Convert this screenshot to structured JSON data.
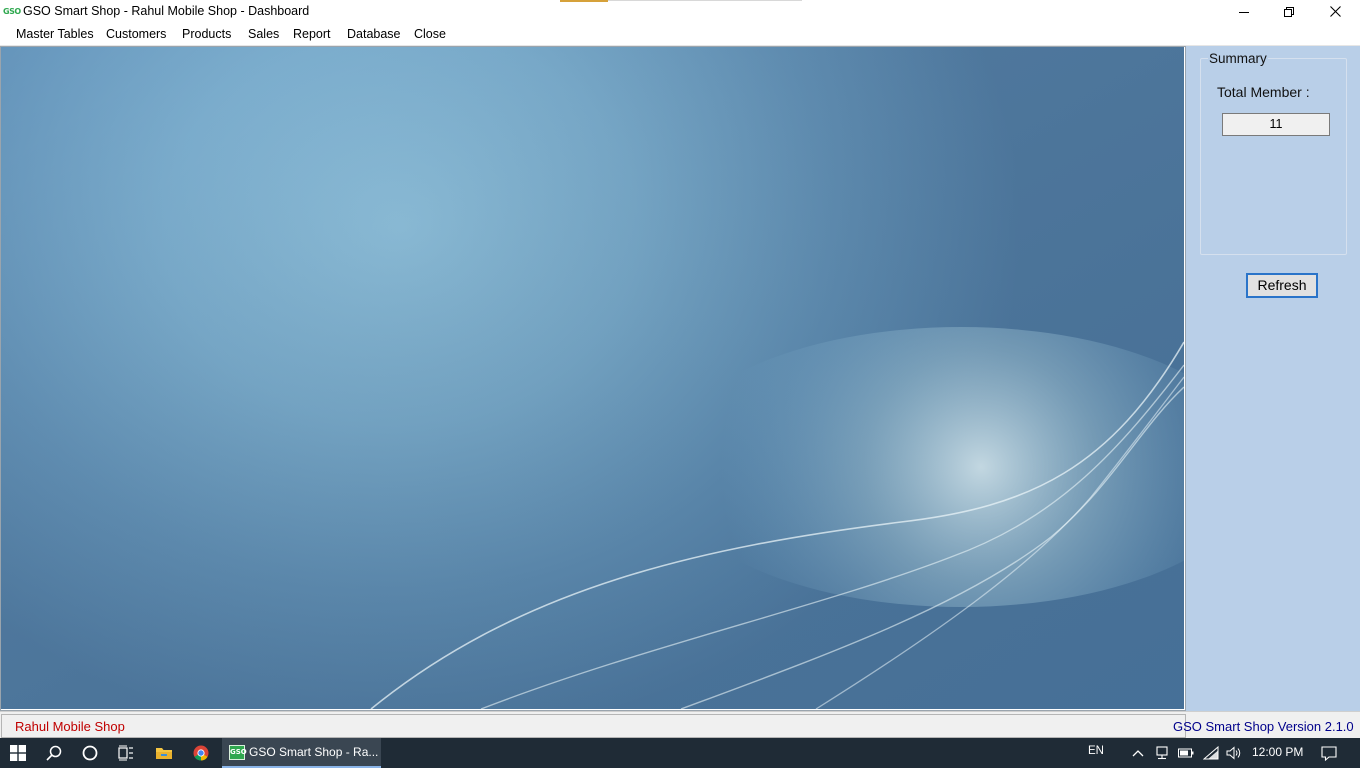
{
  "window": {
    "logo_text": "GSO",
    "title": "GSO Smart Shop - Rahul Mobile Shop - Dashboard",
    "controls": [
      "minimize",
      "restore",
      "close"
    ]
  },
  "menu": {
    "items": [
      "Master Tables",
      "Customers",
      "Products",
      "Sales",
      "Report",
      "Database",
      "Close"
    ]
  },
  "summary": {
    "legend": "Summary",
    "total_member_label": "Total Member :",
    "total_member_value": "11",
    "refresh_label": "Refresh"
  },
  "status": {
    "shop_name": "Rahul Mobile Shop",
    "version": "GSO Smart Shop Version 2.1.0"
  },
  "taskbar": {
    "app_label": "GSO Smart Shop - Ra...",
    "app_logo_text": "GSO",
    "language": "EN",
    "clock": "12:00 PM",
    "icons": [
      "windows-start-icon",
      "search-icon",
      "cortana-icon",
      "task-view-icon",
      "file-explorer-icon",
      "chrome-icon"
    ],
    "tray_icons": [
      "chevron-up-icon",
      "network-icon",
      "battery-icon",
      "wifi-icon",
      "volume-icon",
      "notification-icon"
    ]
  },
  "colors": {
    "panel": "#b9cfe8",
    "shop_name": "#c00000",
    "version": "#00008b",
    "taskbar": "#1f2b36",
    "button_focus": "#2a74c9"
  }
}
